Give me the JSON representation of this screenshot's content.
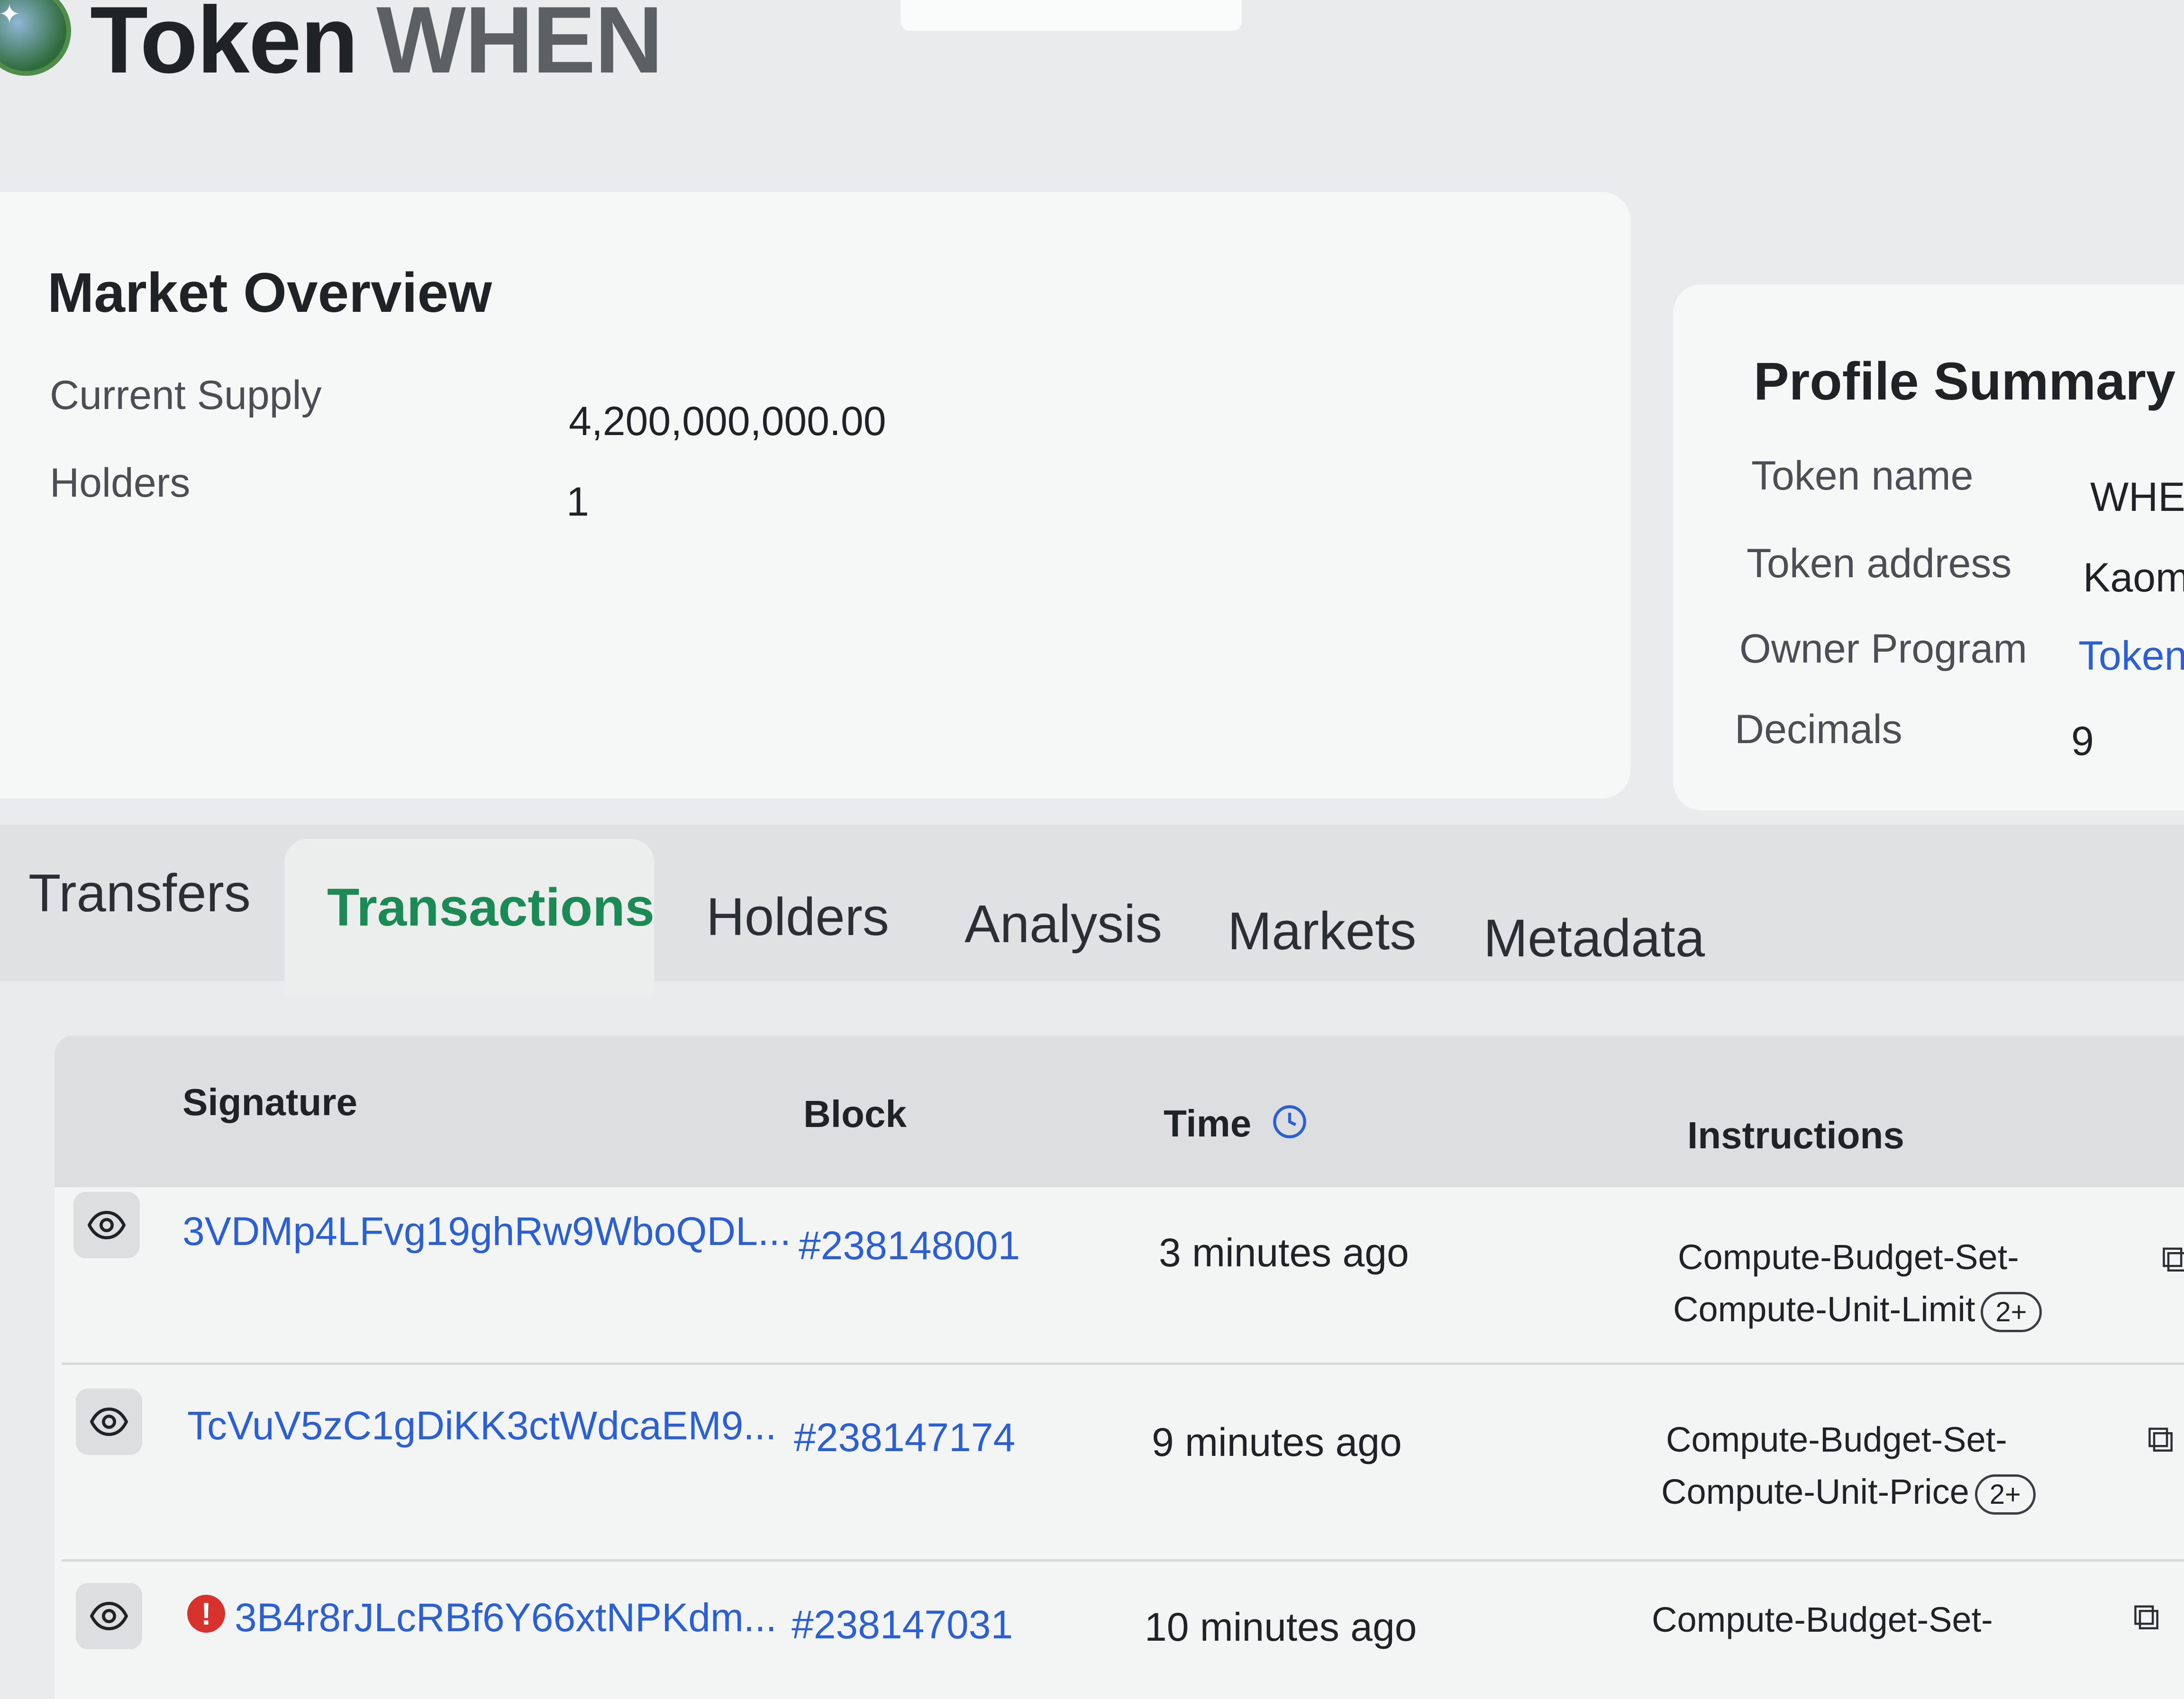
{
  "header": {
    "title_prefix": "Token",
    "title_symbol": "WHEN"
  },
  "market_overview": {
    "title": "Market Overview",
    "rows": [
      {
        "label": "Current Supply",
        "value": "4,200,000,000.00"
      },
      {
        "label": "Holders",
        "value": "1"
      }
    ]
  },
  "profile_summary": {
    "title": "Profile Summary",
    "rows": [
      {
        "label": "Token name",
        "value": "WHEN"
      },
      {
        "label": "Token address",
        "value": "Kaomo"
      },
      {
        "label": "Owner Program",
        "value": "Token P"
      },
      {
        "label": "Decimals",
        "value": "9"
      }
    ]
  },
  "tabs": [
    {
      "label": "Transfers",
      "active": false
    },
    {
      "label": "Transactions",
      "active": true
    },
    {
      "label": "Holders",
      "active": false
    },
    {
      "label": "Analysis",
      "active": false
    },
    {
      "label": "Markets",
      "active": false
    },
    {
      "label": "Metadata",
      "active": false
    }
  ],
  "table": {
    "columns": [
      "Signature",
      "Block",
      "Time",
      "Instructions"
    ],
    "rows": [
      {
        "signature": "3VDMp4LFvg19ghRw9WboQDL...",
        "block": "#238148001",
        "time": "3 minutes ago",
        "instr_line1": "Compute-Budget-Set-",
        "instr_line2": "Compute-Unit-Limit",
        "badge": "2+",
        "error": false
      },
      {
        "signature": "TcVuV5zC1gDiKK3ctWdcaEM9...",
        "block": "#238147174",
        "time": "9 minutes ago",
        "instr_line1": "Compute-Budget-Set-",
        "instr_line2": "Compute-Unit-Price",
        "badge": "2+",
        "error": false
      },
      {
        "signature": "3B4r8rJLcRBf6Y66xtNPKdm...",
        "block": "#238147031",
        "time": "10 minutes ago",
        "instr_line1": "Compute-Budget-Set-",
        "instr_line2": "",
        "badge": "",
        "error": true
      }
    ]
  },
  "colors": {
    "accent": "#1c8a55",
    "link": "#2a5fd6",
    "error": "#d8322e"
  },
  "icons": {
    "view": "eye-icon",
    "time": "clock-icon",
    "copy": "copy-icon",
    "error": "error-icon"
  }
}
